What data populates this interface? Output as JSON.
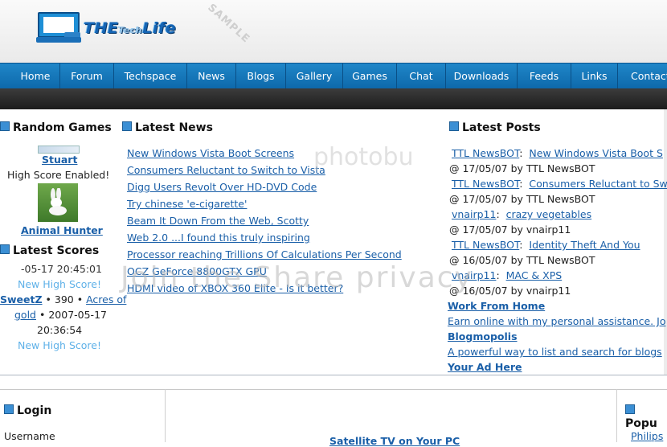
{
  "logo": {
    "word1": "THE",
    "word2": "Tech",
    "word3": "Life",
    "watermark": "SAMPLE"
  },
  "nav": [
    "Home",
    "Forum",
    "Techspace",
    "News",
    "Blogs",
    "Gallery",
    "Games",
    "Chat",
    "Downloads",
    "Feeds",
    "Links",
    "Contact"
  ],
  "random_games": {
    "title": "Random Games",
    "user": "Stuart",
    "note": "High Score Enabled!",
    "game_name": "Animal Hunter"
  },
  "latest_scores": {
    "title": "Latest Scores",
    "line1": "-05-17 20:45:01",
    "line2": "New High Score!",
    "user": "SweetZ",
    "score_sep": "• 390 •",
    "game": "Acres of",
    "game2": "gold",
    "date": "• 2007-05-17",
    "time": "20:36:54",
    "line_last": "New High Score!"
  },
  "latest_news": {
    "title": "Latest News",
    "items": [
      "New Windows Vista Boot Screens",
      "Consumers Reluctant to Switch to Vista",
      "Digg Users Revolt Over HD-DVD Code",
      "Try chinese 'e-cigarette'",
      "Beam It Down From the Web, Scotty",
      "Web 2.0 ...I found this truly inspiring",
      "Processor reaching Trillions Of Calculations Per Second",
      "OCZ GeForce 8800GTX GPU",
      "HDMI video of XBOX 360 Elite - Is it better?"
    ]
  },
  "latest_posts": {
    "title": "Latest Posts",
    "posts": [
      {
        "user": "TTL NewsBOT",
        "topic": "New Windows Vista Boot S",
        "meta": "@ 17/05/07 by TTL NewsBOT"
      },
      {
        "user": "TTL NewsBOT",
        "topic": "Consumers Reluctant to Sw",
        "meta": "@ 17/05/07 by TTL NewsBOT"
      },
      {
        "user": "vnairp11",
        "topic": "crazy vegetables",
        "meta": "@ 17/05/07 by vnairp11"
      },
      {
        "user": "TTL NewsBOT",
        "topic": "Identity Theft And You",
        "meta": "@ 16/05/07 by TTL NewsBOT"
      },
      {
        "user": "vnairp11",
        "topic": "MAC & XPS",
        "meta": "@ 16/05/07 by vnairp11"
      }
    ],
    "ads": [
      {
        "title": "Work From Home",
        "desc": "Earn online with my personal assistance. Jo"
      },
      {
        "title": "Blogmopolis",
        "desc": "A powerful way to list and search for blogs"
      },
      {
        "title": "Your Ad Here",
        "desc": ""
      }
    ]
  },
  "photobucket_watermark": "Join the Share privacy",
  "photobucket_watermark2": "photobu",
  "login": {
    "title": "Login",
    "username_label": "Username"
  },
  "center_promo": "Satellite TV on Your PC",
  "popular": {
    "title": "Popu",
    "item": "Philips"
  }
}
